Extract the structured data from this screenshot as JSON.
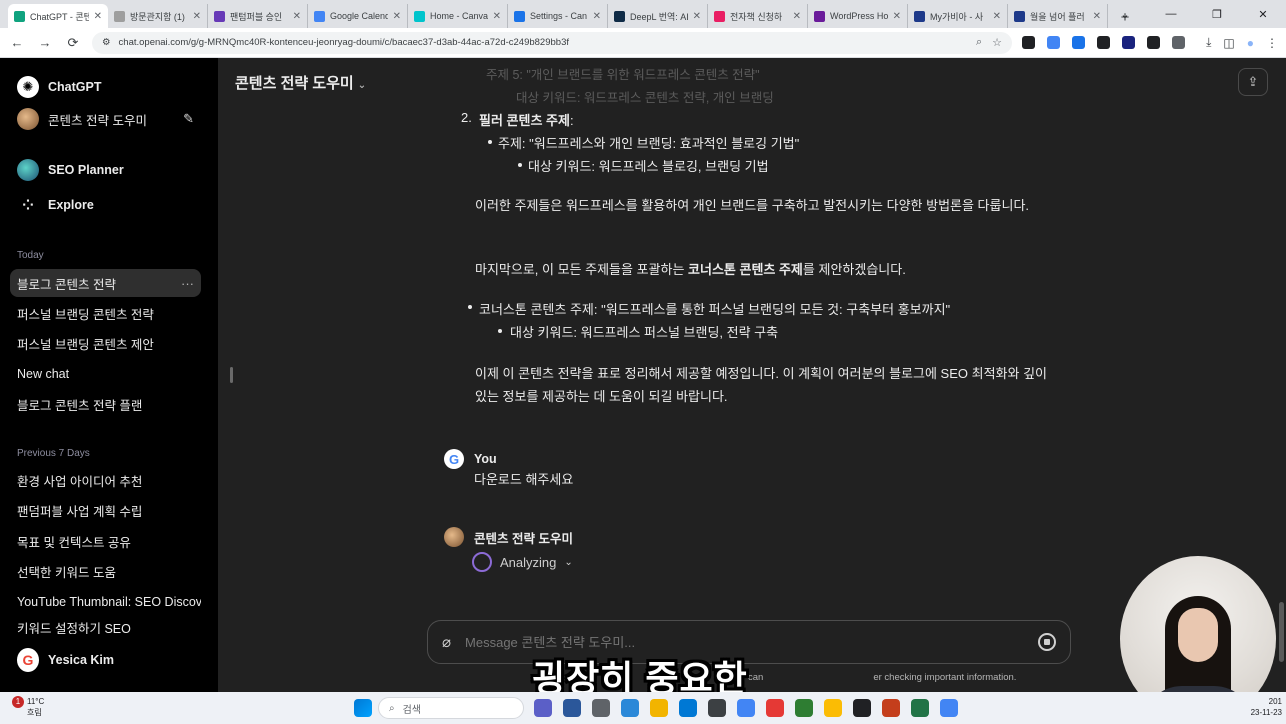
{
  "browser": {
    "tabs": [
      {
        "label": "ChatGPT - 콘텐",
        "color": "#10a37f",
        "active": true
      },
      {
        "label": "방문관지함 (1)",
        "color": "#9e9e9e"
      },
      {
        "label": "팬텀퍼블 승인",
        "color": "#673ab7"
      },
      {
        "label": "Google Calend",
        "color": "#4285f4"
      },
      {
        "label": "Home - Canva",
        "color": "#00c4cc"
      },
      {
        "label": "Settings - Can",
        "color": "#1a73e8"
      },
      {
        "label": "DeepL 번역: AI",
        "color": "#0f2b46"
      },
      {
        "label": "전자책 신청하",
        "color": "#e91e63"
      },
      {
        "label": "WordPress Ho",
        "color": "#6a1b9a"
      },
      {
        "label": "My가비아 - 사",
        "color": "#1e3a8a"
      },
      {
        "label": "월을 넘어 플러",
        "color": "#1e3a8a"
      }
    ],
    "new_tab": "+",
    "window_controls": [
      "⌄",
      "—",
      "❐",
      "✕"
    ],
    "nav": {
      "back": "←",
      "forward": "→",
      "reload": "⟳",
      "site_info": "⚙"
    },
    "url": "chat.openai.com/g/g-MRNQmc40R-kontenceu-jeonryag-doumi/c/bacaec37-d3ab-44ac-a72d-c249b829bb3f",
    "omni_icons": {
      "zoom": "⌕",
      "star": "☆"
    },
    "extension_colors": [
      "#202124",
      "#4285f4",
      "#1a73e8",
      "#202124",
      "#1a237e",
      "#202124",
      "#5f6368"
    ],
    "toolbar_right": {
      "download": "⤓",
      "sidepanel": "◫",
      "profile": "●",
      "menu": "⋮"
    }
  },
  "sidebar": {
    "app_name": "ChatGPT",
    "current_gpt": "콘텐츠 전략 도우미",
    "edit_icon": "✎",
    "gpts": [
      {
        "label": "SEO Planner"
      },
      {
        "label": "Explore",
        "icon": "⁘"
      }
    ],
    "today_label": "Today",
    "today": [
      {
        "label": "블로그 콘텐츠 전략",
        "selected": true,
        "more": "···"
      },
      {
        "label": "퍼스널 브랜딩 콘텐츠 전략"
      },
      {
        "label": "퍼스널 브랜딩 콘텐츠 제안"
      },
      {
        "label": "New chat"
      },
      {
        "label": "블로그 콘텐츠 전략 플랜"
      }
    ],
    "prev7_label": "Previous 7 Days",
    "prev7": [
      {
        "label": "환경 사업 아이디어 추천"
      },
      {
        "label": "팬덤퍼블 사업 계획 수립"
      },
      {
        "label": "목표 및 컨텍스트 공유"
      },
      {
        "label": "선택한 키워드 도움"
      },
      {
        "label": "YouTube Thumbnail: SEO Discove"
      },
      {
        "label": "키워드 설정하기 SEO"
      }
    ],
    "user_name": "Yesica Kim",
    "user_avatar_letter": "G"
  },
  "chat": {
    "title": "콘텐츠 전략 도우미",
    "title_chevron": "⌄",
    "share_icon": "⇪",
    "faded_top": [
      "주제 5: \"개인 브랜드를 위한 워드프레스 콘텐츠 전략\"",
      "대상 키워드: 워드프레스 콘텐츠 전략, 개인 브랜딩"
    ],
    "item2_number": "2.",
    "item2_heading": "필러 콘텐츠 주제",
    "item2_colon": ":",
    "item2_topic": "주제: \"워드프레스와 개인 브랜딩: 효과적인 블로깅 기법\"",
    "item2_keywords": "대상 키워드: 워드프레스 블로깅, 브랜딩 기법",
    "para1": "이러한 주제들은 워드프레스를 활용하여 개인 브랜드를 구축하고 발전시키는 다양한 방법론을 다룹니다.",
    "para2_before": "마지막으로, 이 모든 주제들을 포괄하는 ",
    "para2_bold": "코너스톤 콘텐츠 주제",
    "para2_after": "를 제안하겠습니다.",
    "cornerstone_topic": "코너스톤 콘텐츠 주제: \"워드프레스를 통한 퍼스널 브랜딩의 모든 것: 구축부터 홍보까지\"",
    "cornerstone_keywords": "대상 키워드: 워드프레스 퍼스널 브랜딩, 전략 구축",
    "para3": "이제 이 콘텐츠 전략을 표로 정리해서 제공할 예정입니다. 이 계획이 여러분의 블로그에 SEO 최적화와 깊이 있는 정보를 제공하는 데 도움이 되길 바랍니다.",
    "user_label": "You",
    "user_message": "다운로드 해주세요",
    "assistant_label": "콘텐츠 전략 도우미",
    "status": "Analyzing",
    "status_chevron": "⌄",
    "composer_placeholder": "Message 콘텐츠 전략 도우미...",
    "attach_icon": "⌀",
    "disclaimer_left": "can",
    "disclaimer_right": "er checking important information.",
    "overlay_caption": "굉장히 중요한"
  },
  "taskbar": {
    "weather_temp": "11°C",
    "weather_desc": "흐림",
    "weather_badge": "1",
    "search_placeholder": "검색",
    "search_icon": "⌕",
    "start_colors": [
      "#0078d4"
    ],
    "app_colors": [
      "#5b5fc7",
      "#2b579a",
      "#5f6368",
      "#2b88d8",
      "#f2b400",
      "#0078d4",
      "#3c4043",
      "#4285f4",
      "#e53935",
      "#2e7d32",
      "#fbbc04",
      "#202124",
      "#c43e1c",
      "#217346",
      "#4285f4"
    ],
    "clock_time": "201",
    "clock_date": "23-11-23"
  },
  "colors": {
    "sidebar_bg": "#000000",
    "main_bg": "#212121",
    "text": "#ececec",
    "spinner": "#8c6bd6"
  }
}
